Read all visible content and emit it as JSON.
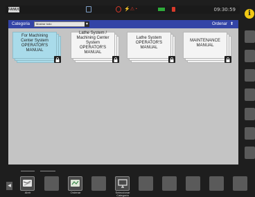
{
  "status_bar": {
    "logo": "FANUC",
    "clock": "09:30:59"
  },
  "category_bar": {
    "label": "Categoria",
    "selected": "Mostrar todo",
    "order_label": "Ordenar"
  },
  "manuals": [
    {
      "title": "For Machining Center System OPERATOR'S MANUAL",
      "selected": true,
      "locked": true
    },
    {
      "title": "Lathe System / Machining Center System OPERATOR'S MANUAL",
      "selected": false,
      "locked": true
    },
    {
      "title": "Lathe System OPERATOR'S MANUAL",
      "selected": false,
      "locked": true
    },
    {
      "title": "MAINTENANCE MANUAL",
      "selected": false,
      "locked": true
    }
  ],
  "dock": {
    "open_label": "Abrir",
    "sort_label": "Ordenar",
    "select_category_label": "Seleccionar Categoría"
  },
  "colors": {
    "category_bar": "#3344a6",
    "selected_card": "#a9dbea",
    "workspace": "#c4c4c4",
    "info_icon": "#f0c814"
  }
}
